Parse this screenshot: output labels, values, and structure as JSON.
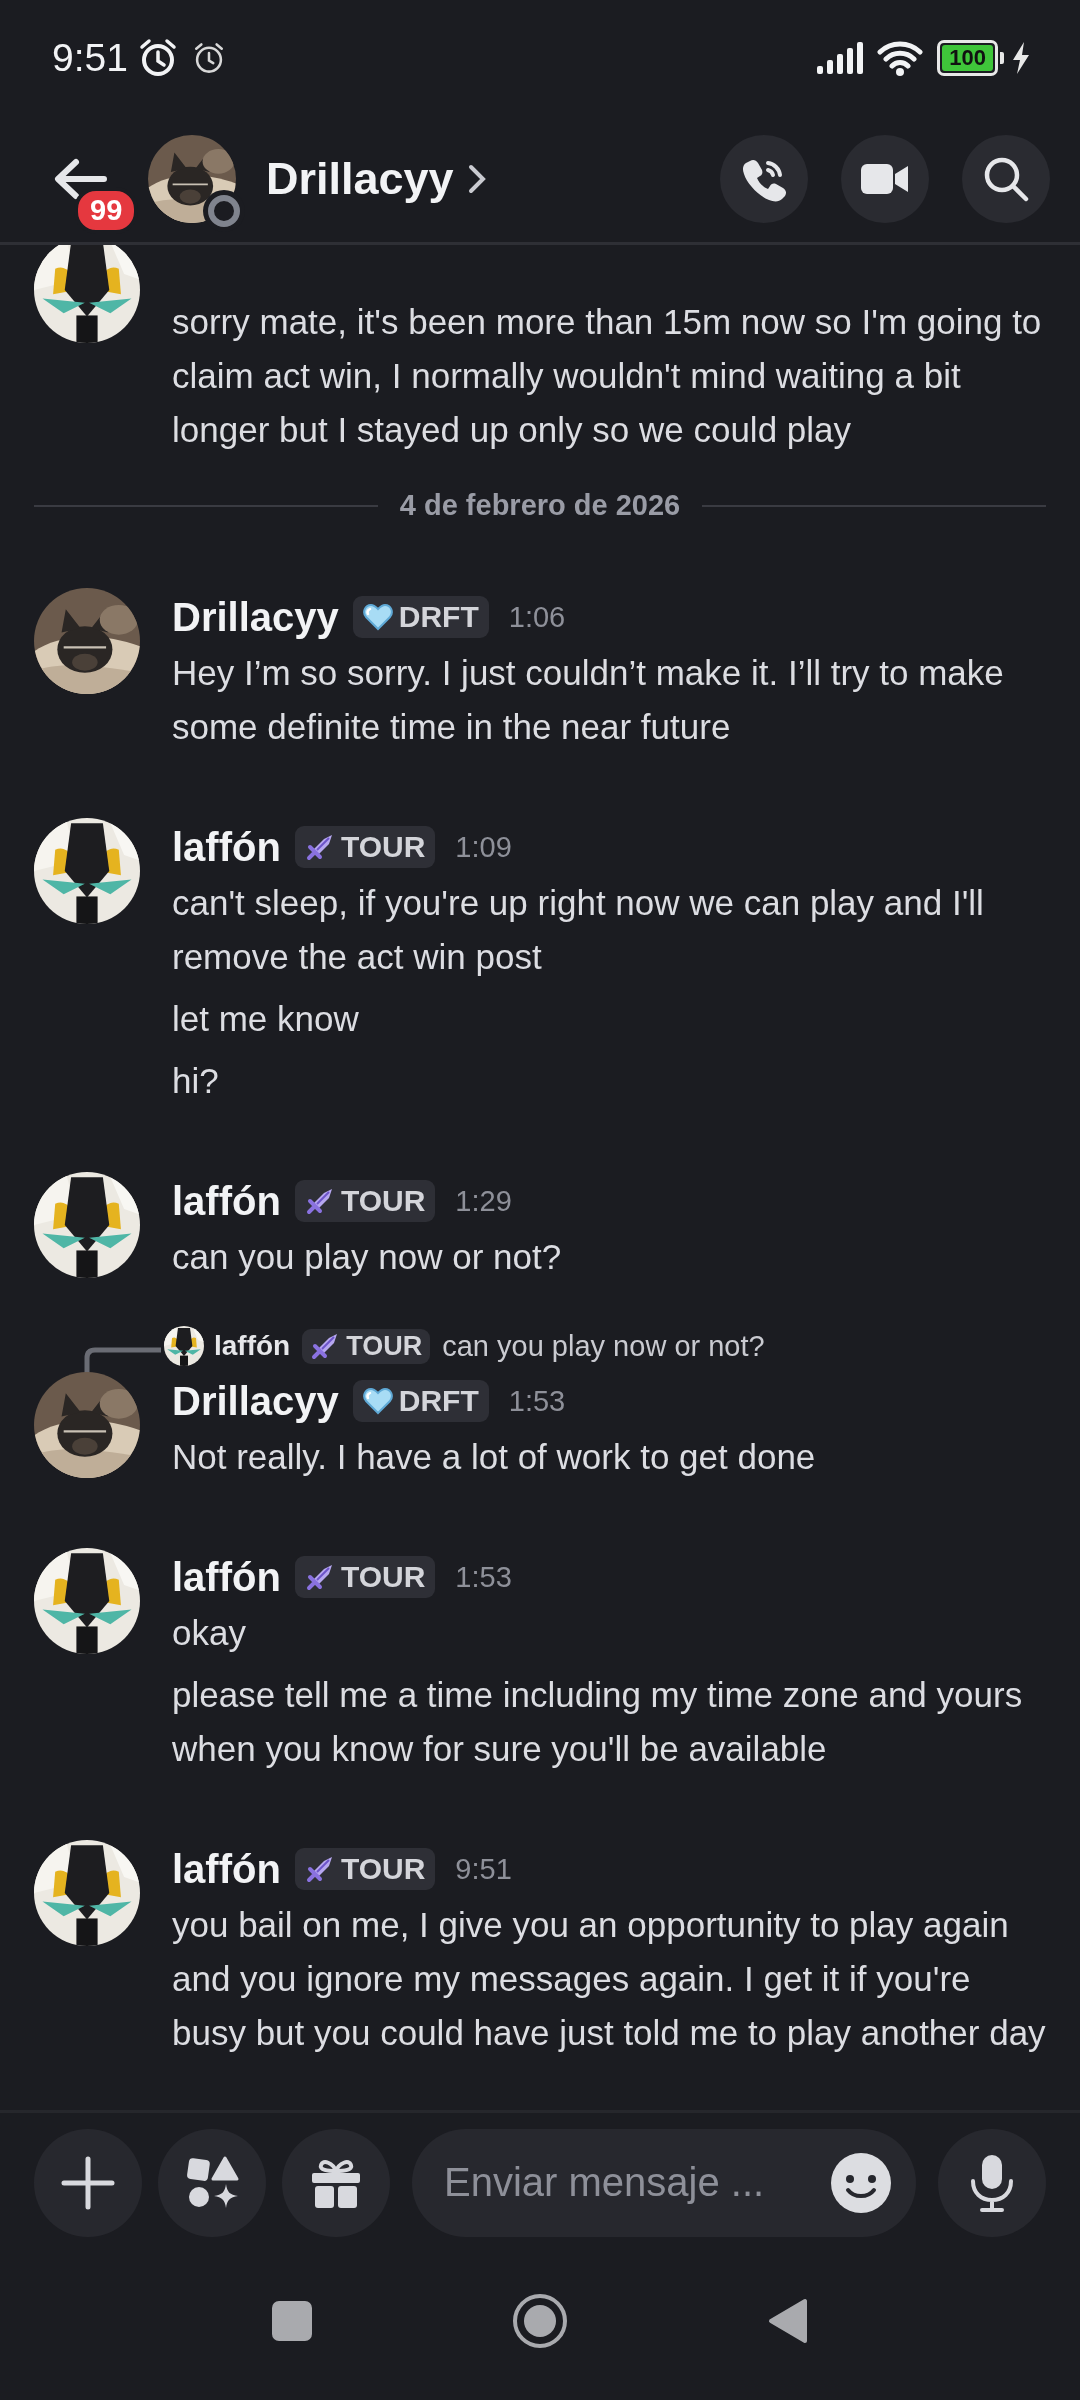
{
  "status_bar": {
    "time": "9:51",
    "battery": "100"
  },
  "header": {
    "title": "Drillacyy",
    "unread_badge": "99",
    "online": false
  },
  "messages": [
    {
      "kind": "continued",
      "from_self": true,
      "texts": [
        "sorry mate, it's been more than 15m now so I'm going to claim act win, I normally wouldn't mind waiting a bit longer but I stayed up only so we could play"
      ]
    },
    {
      "kind": "divider",
      "label": "4 de febrero de 2026"
    },
    {
      "kind": "group",
      "from_self": false,
      "author": "Drillacyy",
      "tag": "DRFT",
      "time": "1:06",
      "texts": [
        "Hey I’m so sorry. I just couldn’t make it. I’ll try to make some definite time in the near future"
      ]
    },
    {
      "kind": "group",
      "from_self": true,
      "author": "laffón",
      "tag": "TOUR",
      "time": "1:09",
      "texts": [
        "can't sleep, if you're up right now we can play and I'll remove the act win post",
        "let me know",
        "hi?"
      ]
    },
    {
      "kind": "group",
      "from_self": true,
      "author": "laffón",
      "tag": "TOUR",
      "time": "1:29",
      "texts": [
        "can you play now or not?"
      ]
    },
    {
      "kind": "group",
      "from_self": false,
      "author": "Drillacyy",
      "tag": "DRFT",
      "time": "1:53",
      "reply": {
        "from_self": true,
        "author": "laffón",
        "tag": "TOUR",
        "text": "can you play now or not?"
      },
      "texts": [
        "Not really. I have a lot of work to get done"
      ]
    },
    {
      "kind": "group",
      "from_self": true,
      "author": "laffón",
      "tag": "TOUR",
      "time": "1:53",
      "texts": [
        "okay",
        "please tell me a time including my time zone and yours when you know for sure you'll be available"
      ]
    },
    {
      "kind": "group",
      "from_self": true,
      "author": "laffón",
      "tag": "TOUR",
      "time": "9:51",
      "texts": [
        "you bail on me, I give you an opportunity to play again and you ignore my messages again. I get it if you're busy but you could have just told me to play another day"
      ]
    }
  ],
  "composer": {
    "placeholder": "Enviar mensaje ..."
  }
}
